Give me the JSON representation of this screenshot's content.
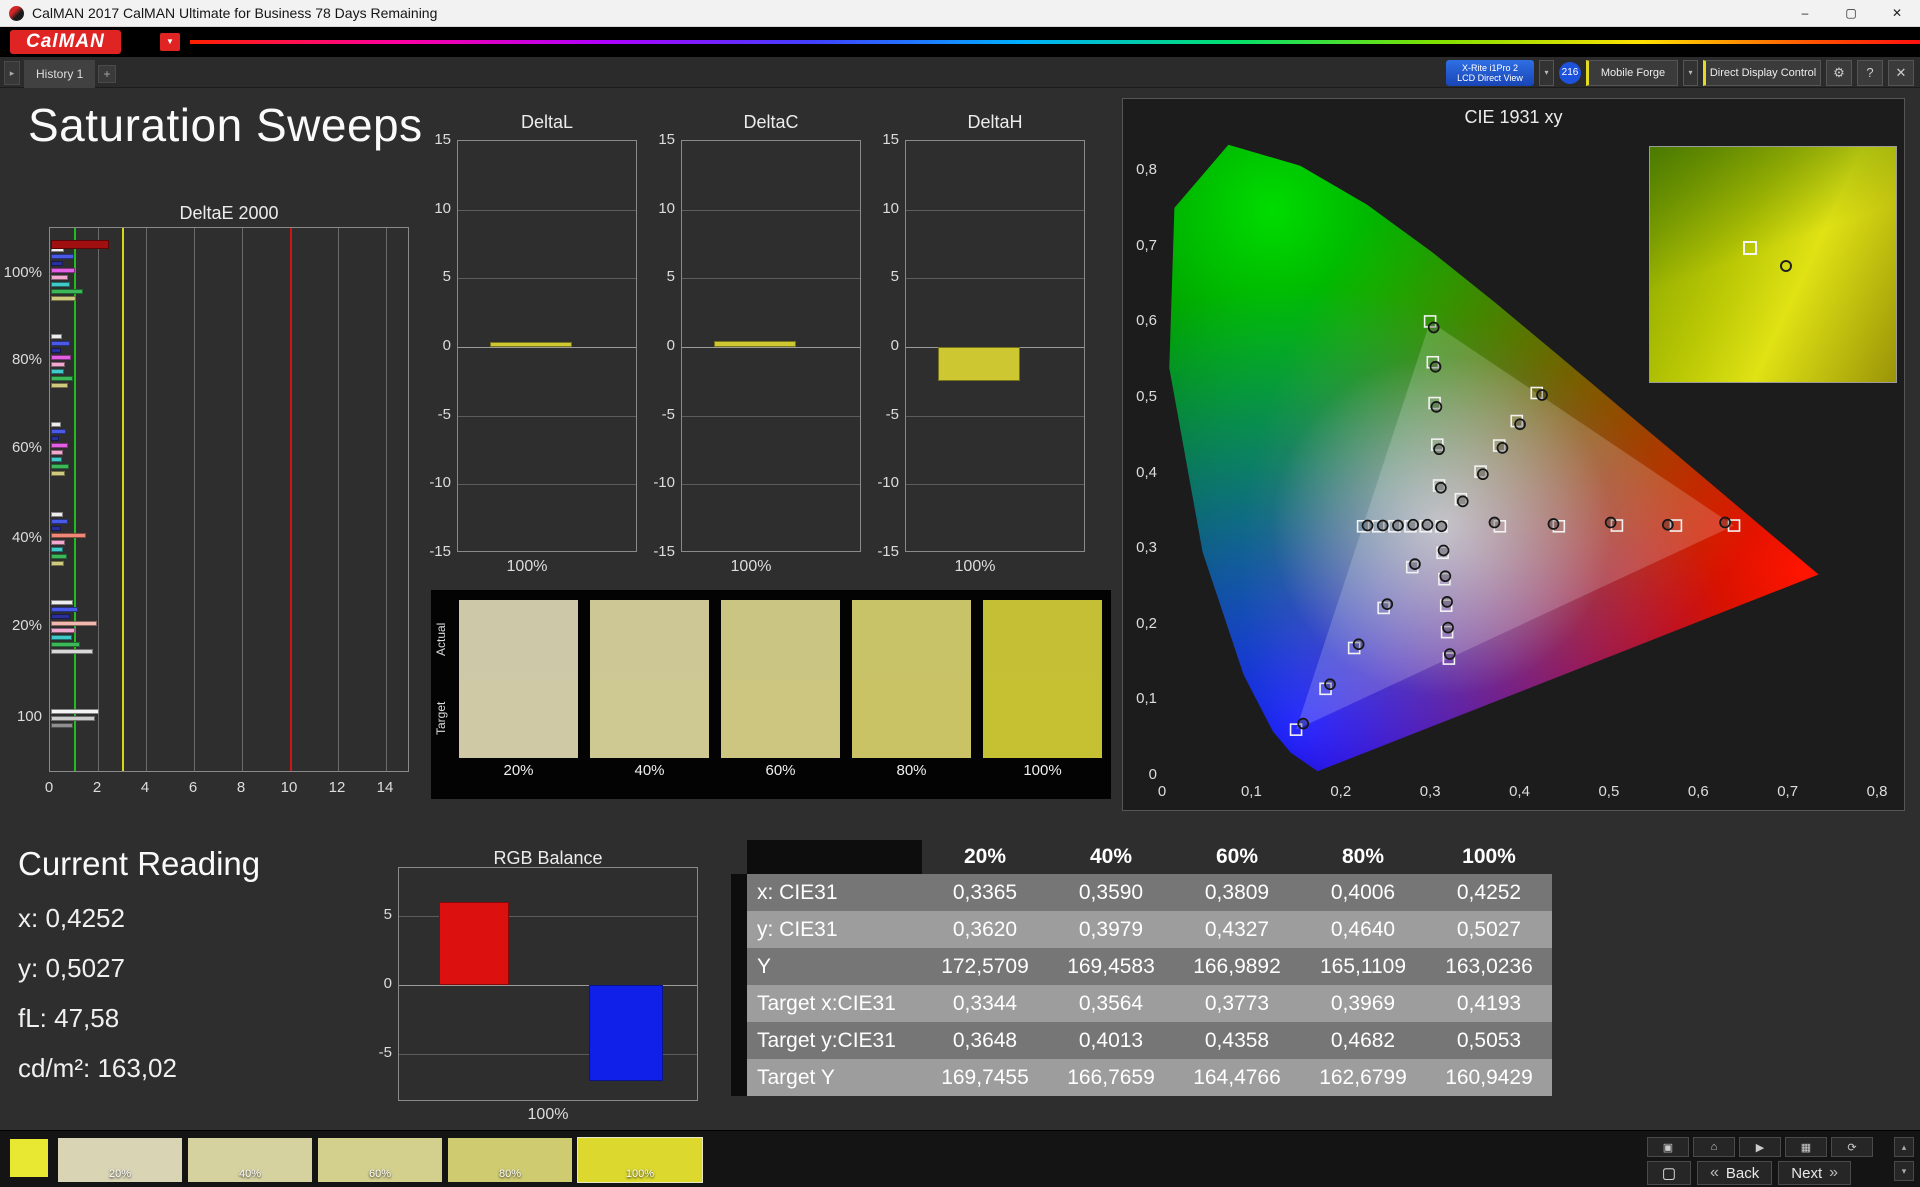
{
  "window": {
    "title": "CalMAN 2017 CalMAN Ultimate for Business 78 Days Remaining",
    "brand": "CalMAN",
    "logo_arrow": "▼",
    "controls": {
      "minimize": "–",
      "maximize": "▢",
      "close": "✕"
    }
  },
  "tabbar": {
    "scroll_glyph": "▸",
    "tab": "History 1",
    "add": "+",
    "meter": {
      "line1": "X-Rite i1Pro 2",
      "line2": "LCD Direct View"
    },
    "dropdown": "▾",
    "badge": "216",
    "source": "Mobile Forge",
    "display_control": "Direct Display Control",
    "gear": "⚙",
    "help": "?",
    "close": "✕"
  },
  "page": {
    "title": "Saturation Sweeps"
  },
  "charts": {
    "deltae": {
      "title": "DeltaE 2000",
      "xticks": [
        0,
        2,
        4,
        6,
        8,
        10,
        12,
        14
      ],
      "xmax": 14,
      "ref_lines": {
        "green": 1,
        "yellow": 3,
        "red": 10
      },
      "top_bar": {
        "c": "#a01010",
        "v": 2.4
      },
      "groups": [
        {
          "label": "100%",
          "pos": 0.086,
          "bars": [
            {
              "c": "#ededed",
              "v": 0.55
            },
            {
              "c": "#4a5ae8",
              "v": 0.95
            },
            {
              "c": "#2a2f9a",
              "v": 0.5
            },
            {
              "c": "#e35fe3",
              "v": 1.0
            },
            {
              "c": "#f2a9cf",
              "v": 0.7
            },
            {
              "c": "#3fc9c9",
              "v": 0.78
            },
            {
              "c": "#3cb85a",
              "v": 1.35
            },
            {
              "c": "#cfcb7e",
              "v": 1.05
            }
          ]
        },
        {
          "label": "80%",
          "pos": 0.246,
          "bars": [
            {
              "c": "#ededed",
              "v": 0.45
            },
            {
              "c": "#4a5ae8",
              "v": 0.8
            },
            {
              "c": "#2a2f9a",
              "v": 0.42
            },
            {
              "c": "#e35fe3",
              "v": 0.85
            },
            {
              "c": "#f2a9cf",
              "v": 0.6
            },
            {
              "c": "#3fc9c9",
              "v": 0.55
            },
            {
              "c": "#3cb85a",
              "v": 0.9
            },
            {
              "c": "#cfcb7e",
              "v": 0.72
            }
          ]
        },
        {
          "label": "60%",
          "pos": 0.407,
          "bars": [
            {
              "c": "#ededed",
              "v": 0.4
            },
            {
              "c": "#4a5ae8",
              "v": 0.62
            },
            {
              "c": "#2a2f9a",
              "v": 0.35
            },
            {
              "c": "#e35fe3",
              "v": 0.7
            },
            {
              "c": "#f2a9cf",
              "v": 0.5
            },
            {
              "c": "#3fc9c9",
              "v": 0.46
            },
            {
              "c": "#3cb85a",
              "v": 0.75
            },
            {
              "c": "#cfcb7e",
              "v": 0.6
            }
          ]
        },
        {
          "label": "40%",
          "pos": 0.572,
          "bars": [
            {
              "c": "#ededed",
              "v": 0.5
            },
            {
              "c": "#4a5ae8",
              "v": 0.7
            },
            {
              "c": "#2a2f9a",
              "v": 0.4
            },
            {
              "c": "#f08878",
              "v": 1.45
            },
            {
              "c": "#f2a9cf",
              "v": 0.6
            },
            {
              "c": "#3fc9c9",
              "v": 0.5
            },
            {
              "c": "#3cb85a",
              "v": 0.66
            },
            {
              "c": "#cfcb7e",
              "v": 0.55
            }
          ]
        },
        {
          "label": "20%",
          "pos": 0.734,
          "bars": [
            {
              "c": "#ededed",
              "v": 0.9
            },
            {
              "c": "#4a5ae8",
              "v": 1.12
            },
            {
              "c": "#2a2f9a",
              "v": 0.8
            },
            {
              "c": "#f2b8b0",
              "v": 1.9
            },
            {
              "c": "#f2a9cf",
              "v": 1.0
            },
            {
              "c": "#3fc9c9",
              "v": 0.86
            },
            {
              "c": "#3cb85a",
              "v": 1.2
            },
            {
              "c": "#d8d8d8",
              "v": 1.75
            }
          ]
        },
        {
          "label": "100",
          "pos": 0.901,
          "bars": [
            {
              "c": "#f4f4f4",
              "v": 2.0
            },
            {
              "c": "#cccccc",
              "v": 1.85
            },
            {
              "c": "#8f8f8f",
              "v": 0.9
            }
          ]
        }
      ]
    },
    "deltal": {
      "title": "DeltaL",
      "value": 0.35,
      "xlabel": "100%",
      "yticks": [
        15,
        10,
        5,
        0,
        -5,
        -10,
        -15
      ]
    },
    "deltac": {
      "title": "DeltaC",
      "value": 0.45,
      "xlabel": "100%",
      "yticks": [
        15,
        10,
        5,
        0,
        -5,
        -10,
        -15
      ]
    },
    "deltah": {
      "title": "DeltaH",
      "value": -2.5,
      "xlabel": "100%",
      "yticks": [
        15,
        10,
        5,
        0,
        -5,
        -10,
        -15
      ]
    },
    "rgb": {
      "title": "RGB Balance",
      "xlabel": "100%",
      "yticks": [
        5,
        0,
        -5
      ],
      "range": 8.5,
      "series": [
        {
          "name": "red",
          "value": 6,
          "color": "#dd1010"
        },
        {
          "name": "green",
          "value": 0,
          "color": "#10c010"
        },
        {
          "name": "blue",
          "value": -7,
          "color": "#1020e8"
        }
      ]
    }
  },
  "swatch_strip": {
    "row_labels": [
      "Actual",
      "Target"
    ],
    "items": [
      {
        "label": "20%",
        "actual": "#cdc8a8",
        "target": "#cfc9a6"
      },
      {
        "label": "40%",
        "actual": "#cdc795",
        "target": "#cec893"
      },
      {
        "label": "60%",
        "actual": "#cbc583",
        "target": "#ccc681"
      },
      {
        "label": "80%",
        "actual": "#c8c268",
        "target": "#c9c366"
      },
      {
        "label": "100%",
        "actual": "#c5bf35",
        "target": "#c6c033"
      }
    ]
  },
  "cie": {
    "title": "CIE 1931 xy",
    "x_ticks": [
      "0",
      "0,1",
      "0,2",
      "0,3",
      "0,4",
      "0,5",
      "0,6",
      "0,7",
      "0,8"
    ],
    "y_ticks": [
      "0",
      "0,1",
      "0,2",
      "0,3",
      "0,4",
      "0,5",
      "0,6",
      "0,7",
      "0,8"
    ],
    "white_point": [
      0.3127,
      0.329
    ],
    "sweeps": [
      {
        "name": "red",
        "targets": [
          [
            0.378,
            0.329
          ],
          [
            0.444,
            0.329
          ],
          [
            0.509,
            0.33
          ],
          [
            0.575,
            0.33
          ],
          [
            0.64,
            0.33
          ]
        ],
        "measured": [
          [
            0.372,
            0.334
          ],
          [
            0.438,
            0.332
          ],
          [
            0.502,
            0.334
          ],
          [
            0.566,
            0.331
          ],
          [
            0.63,
            0.334
          ]
        ]
      },
      {
        "name": "green",
        "targets": [
          [
            0.31,
            0.383
          ],
          [
            0.308,
            0.437
          ],
          [
            0.305,
            0.492
          ],
          [
            0.303,
            0.546
          ],
          [
            0.3,
            0.6
          ]
        ],
        "measured": [
          [
            0.312,
            0.38
          ],
          [
            0.31,
            0.431
          ],
          [
            0.307,
            0.487
          ],
          [
            0.306,
            0.54
          ],
          [
            0.304,
            0.592
          ]
        ]
      },
      {
        "name": "blue",
        "targets": [
          [
            0.28,
            0.275
          ],
          [
            0.248,
            0.221
          ],
          [
            0.215,
            0.168
          ],
          [
            0.183,
            0.114
          ],
          [
            0.15,
            0.06
          ]
        ],
        "measured": [
          [
            0.283,
            0.279
          ],
          [
            0.252,
            0.226
          ],
          [
            0.22,
            0.173
          ],
          [
            0.188,
            0.12
          ],
          [
            0.158,
            0.068
          ]
        ]
      },
      {
        "name": "cyan",
        "targets": [
          [
            0.295,
            0.329
          ],
          [
            0.278,
            0.329
          ],
          [
            0.26,
            0.329
          ],
          [
            0.242,
            0.329
          ],
          [
            0.225,
            0.329
          ]
        ],
        "measured": [
          [
            0.297,
            0.331
          ],
          [
            0.281,
            0.331
          ],
          [
            0.264,
            0.33
          ],
          [
            0.247,
            0.33
          ],
          [
            0.23,
            0.33
          ]
        ]
      },
      {
        "name": "magenta",
        "targets": [
          [
            0.314,
            0.294
          ],
          [
            0.316,
            0.259
          ],
          [
            0.318,
            0.224
          ],
          [
            0.319,
            0.189
          ],
          [
            0.321,
            0.154
          ]
        ],
        "measured": [
          [
            0.315,
            0.297
          ],
          [
            0.317,
            0.263
          ],
          [
            0.319,
            0.229
          ],
          [
            0.32,
            0.195
          ],
          [
            0.322,
            0.16
          ]
        ]
      },
      {
        "name": "yellow",
        "targets": [
          [
            0.3344,
            0.3648
          ],
          [
            0.3564,
            0.4013
          ],
          [
            0.3773,
            0.4358
          ],
          [
            0.3969,
            0.4682
          ],
          [
            0.4193,
            0.5053
          ]
        ],
        "measured": [
          [
            0.3365,
            0.362
          ],
          [
            0.359,
            0.3979
          ],
          [
            0.3809,
            0.4327
          ],
          [
            0.4006,
            0.464
          ],
          [
            0.4252,
            0.5027
          ]
        ]
      }
    ]
  },
  "current_reading": {
    "title": "Current Reading",
    "lines": [
      {
        "label": "x:",
        "value": "0,4252"
      },
      {
        "label": "y:",
        "value": "0,5027"
      },
      {
        "label": "fL:",
        "value": "47,58"
      },
      {
        "label": "cd/m²:",
        "value": "163,02"
      }
    ]
  },
  "table": {
    "columns": [
      "20%",
      "40%",
      "60%",
      "80%",
      "100%"
    ],
    "rows": [
      {
        "label": "x: CIE31",
        "values": [
          "0,3365",
          "0,3590",
          "0,3809",
          "0,4006",
          "0,4252"
        ]
      },
      {
        "label": "y: CIE31",
        "values": [
          "0,3620",
          "0,3979",
          "0,4327",
          "0,4640",
          "0,5027"
        ]
      },
      {
        "label": "Y",
        "values": [
          "172,5709",
          "169,4583",
          "166,9892",
          "165,1109",
          "163,0236"
        ]
      },
      {
        "label": "Target x:CIE31",
        "values": [
          "0,3344",
          "0,3564",
          "0,3773",
          "0,3969",
          "0,4193"
        ]
      },
      {
        "label": "Target y:CIE31",
        "values": [
          "0,3648",
          "0,4013",
          "0,4358",
          "0,4682",
          "0,5053"
        ]
      },
      {
        "label": "Target Y",
        "values": [
          "169,7455",
          "166,7659",
          "164,4766",
          "162,6799",
          "160,9429"
        ]
      }
    ]
  },
  "bottom_bar": {
    "preview_color": "#e8e832",
    "swatches": [
      {
        "label": "20%",
        "color": "#d8d4b4",
        "selected": false
      },
      {
        "label": "40%",
        "color": "#d6d2a0",
        "selected": false
      },
      {
        "label": "60%",
        "color": "#d3cf8c",
        "selected": false
      },
      {
        "label": "80%",
        "color": "#cfcb70",
        "selected": false
      },
      {
        "label": "100%",
        "color": "#dcd82e",
        "selected": true
      }
    ],
    "nav": {
      "icons": [
        {
          "name": "display",
          "glyph": "▣"
        },
        {
          "name": "home",
          "glyph": "⌂"
        },
        {
          "name": "play",
          "glyph": "▶"
        },
        {
          "name": "save",
          "glyph": "▦"
        },
        {
          "name": "refresh",
          "glyph": "⟳"
        }
      ],
      "stop_glyph": "▢",
      "back_icon": "«",
      "back": "Back",
      "next_icon": "»",
      "next": "Next",
      "up": "▴",
      "down": "▾"
    }
  }
}
